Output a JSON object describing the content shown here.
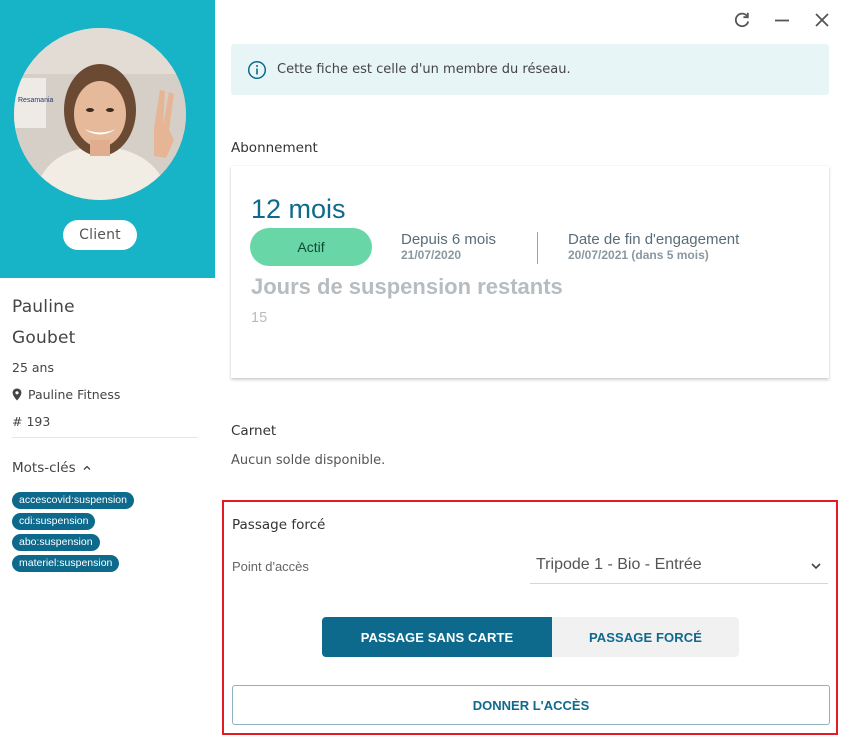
{
  "profile": {
    "role": "Client",
    "first_name": "Pauline",
    "last_name": "Goubet",
    "age": "25 ans",
    "club": "Pauline Fitness",
    "member_number": "# 193",
    "avatar_alt": "Profile photo",
    "sign_text": "Resamania"
  },
  "keywords": {
    "title": "Mots-clés",
    "tags": [
      "accescovid:suspension",
      "cdi:suspension",
      "abo:suspension",
      "materiel:suspension"
    ]
  },
  "banner": {
    "text": "Cette fiche est celle d'un membre du réseau."
  },
  "subscription": {
    "section_title": "Abonnement",
    "duration": "12 mois",
    "status": "Actif",
    "since_label": "Depuis 6 mois",
    "since_date": "21/07/2020",
    "end_label": "Date de fin d'engagement",
    "end_date": "20/07/2021 (dans 5 mois)",
    "suspension_label": "Jours de suspension restants",
    "suspension_days": "15"
  },
  "carnet": {
    "section_title": "Carnet",
    "text": "Aucun solde disponible."
  },
  "forced_passage": {
    "title": "Passage forcé",
    "access_point_label": "Point d'accès",
    "access_point_value": "Tripode 1 - Bio - Entrée",
    "mode_no_card": "PASSAGE SANS CARTE",
    "mode_forced": "PASSAGE FORCÉ",
    "grant_access": "DONNER L'ACCÈS"
  },
  "colors": {
    "hero": "#17b3c7",
    "primary": "#0e6a8c",
    "status_active": "#68d6a6",
    "highlight_border": "#e31b23",
    "banner_bg": "#e8f5f6"
  },
  "icons": [
    "refresh-icon",
    "minimize-icon",
    "close-icon",
    "info-icon",
    "location-pin-icon",
    "chevron-up-icon",
    "chevron-down-icon"
  ]
}
